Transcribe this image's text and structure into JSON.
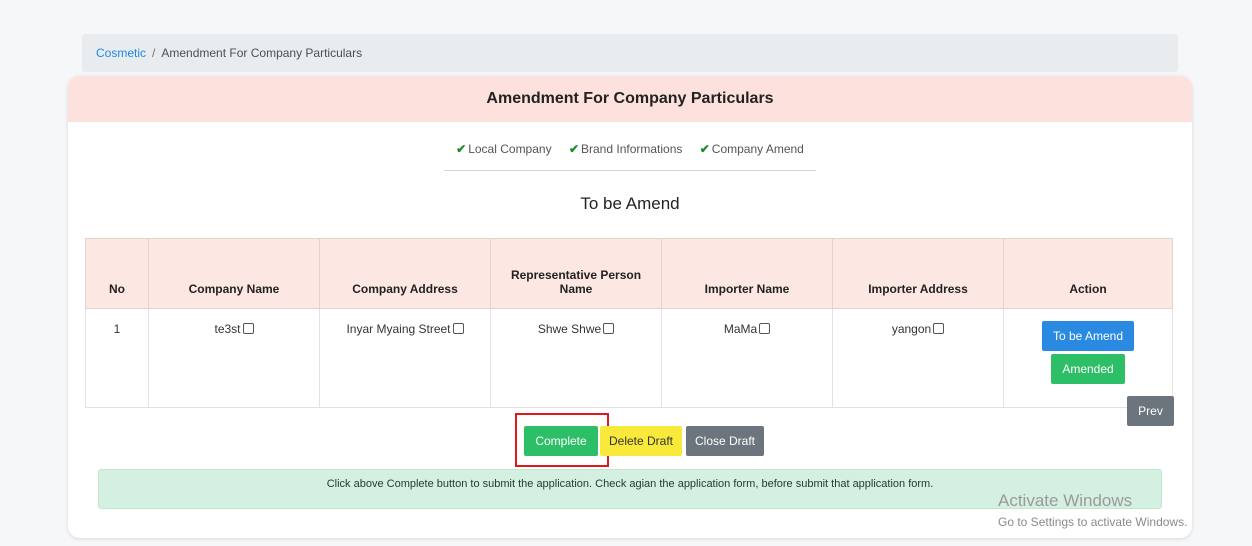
{
  "breadcrumb": {
    "link": "Cosmetic",
    "separator": "/",
    "current": "Amendment For Company Particulars"
  },
  "card": {
    "title": "Amendment For Company Particulars"
  },
  "steps": [
    {
      "label": "Local Company"
    },
    {
      "label": "Brand Informations"
    },
    {
      "label": "Company Amend"
    }
  ],
  "section_title": "To be Amend",
  "table": {
    "headers": [
      "No",
      "Company Name",
      "Company Address",
      "Representative Person Name",
      "Importer Name",
      "Importer Address",
      "Action"
    ],
    "rows": [
      {
        "no": "1",
        "company_name": "te3st",
        "company_address": "Inyar Myaing Street",
        "rep_name": "Shwe Shwe",
        "importer_name": "MaMa",
        "importer_address": "yangon"
      }
    ],
    "actions": {
      "to_be_amend": "To be Amend",
      "amended": "Amended"
    }
  },
  "buttons": {
    "prev": "Prev",
    "complete": "Complete",
    "delete_draft": "Delete Draft",
    "close_draft": "Close Draft"
  },
  "info_message": "Click above Complete button to submit the application. Check agian the application form, before submit that application form.",
  "watermark": {
    "title": "Activate Windows",
    "subtitle": "Go to Settings to activate Windows."
  },
  "colors": {
    "header_bg": "#fde1dc",
    "primary": "#2a8ae2",
    "success": "#2dbf67",
    "warning": "#f8e93a",
    "secondary": "#6c757d",
    "highlight": "#e01a1a"
  }
}
